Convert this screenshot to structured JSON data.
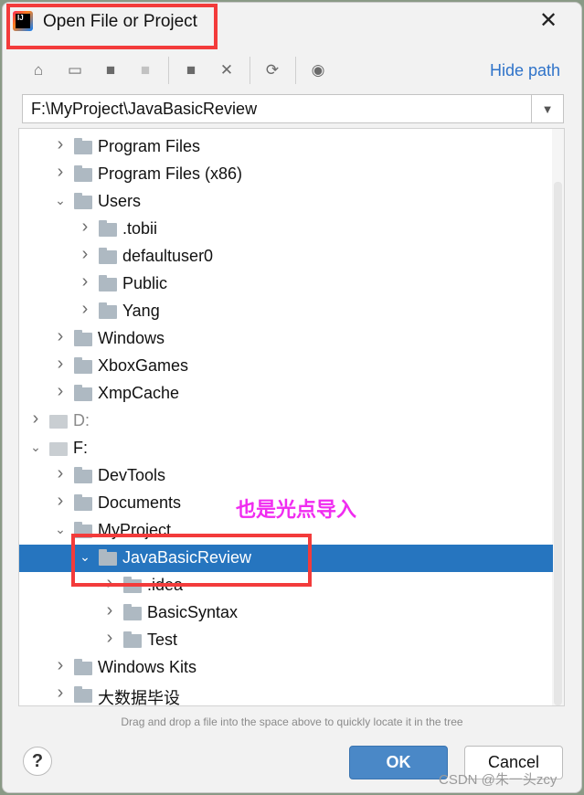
{
  "window": {
    "title": "Open File or Project",
    "close_icon": "close-icon"
  },
  "toolbar": {
    "icons": [
      "home-icon",
      "desktop-icon",
      "project-folder-icon",
      "module-folder-icon",
      "new-folder-icon",
      "delete-icon",
      "refresh-icon",
      "show-hidden-icon"
    ],
    "hide_path": "Hide path"
  },
  "path_field": {
    "value": "F:\\MyProject\\JavaBasicReview"
  },
  "tree": [
    {
      "label": "Program Files",
      "level": 1,
      "expanded": false
    },
    {
      "label": "Program Files (x86)",
      "level": 1,
      "expanded": false
    },
    {
      "label": "Users",
      "level": 1,
      "expanded": true
    },
    {
      "label": ".tobii",
      "level": 2,
      "expanded": false
    },
    {
      "label": "defaultuser0",
      "level": 2,
      "expanded": false
    },
    {
      "label": "Public",
      "level": 2,
      "expanded": false
    },
    {
      "label": "Yang",
      "level": 2,
      "expanded": false
    },
    {
      "label": "Windows",
      "level": 1,
      "expanded": false
    },
    {
      "label": "XboxGames",
      "level": 1,
      "expanded": false
    },
    {
      "label": "XmpCache",
      "level": 1,
      "expanded": false
    },
    {
      "label": "D:",
      "level": 0,
      "expanded": false,
      "drive": true,
      "dim": true
    },
    {
      "label": "F:",
      "level": 0,
      "expanded": true,
      "drive": true
    },
    {
      "label": "DevTools",
      "level": 1,
      "expanded": false
    },
    {
      "label": "Documents",
      "level": 1,
      "expanded": false
    },
    {
      "label": "MyProject",
      "level": 1,
      "expanded": true
    },
    {
      "label": "JavaBasicReview",
      "level": 2,
      "expanded": true,
      "selected": true
    },
    {
      "label": ".idea",
      "level": 3,
      "expanded": false
    },
    {
      "label": "BasicSyntax",
      "level": 3,
      "expanded": false
    },
    {
      "label": "Test",
      "level": 3,
      "expanded": false
    },
    {
      "label": "Windows Kits",
      "level": 1,
      "expanded": false
    },
    {
      "label": "大数据毕设",
      "level": 1,
      "expanded": false
    }
  ],
  "hint": "Drag and drop a file into the space above to quickly locate it in the tree",
  "buttons": {
    "help": "?",
    "ok": "OK",
    "cancel": "Cancel"
  },
  "annotation": {
    "note": "也是光点导入",
    "color": "#f02cf0",
    "box_color": "#f33b3b"
  },
  "watermark": "CSDN @朱一头zcy",
  "colors": {
    "selection": "#2675bf",
    "link": "#2f73c9",
    "ok": "#4a88c7"
  }
}
